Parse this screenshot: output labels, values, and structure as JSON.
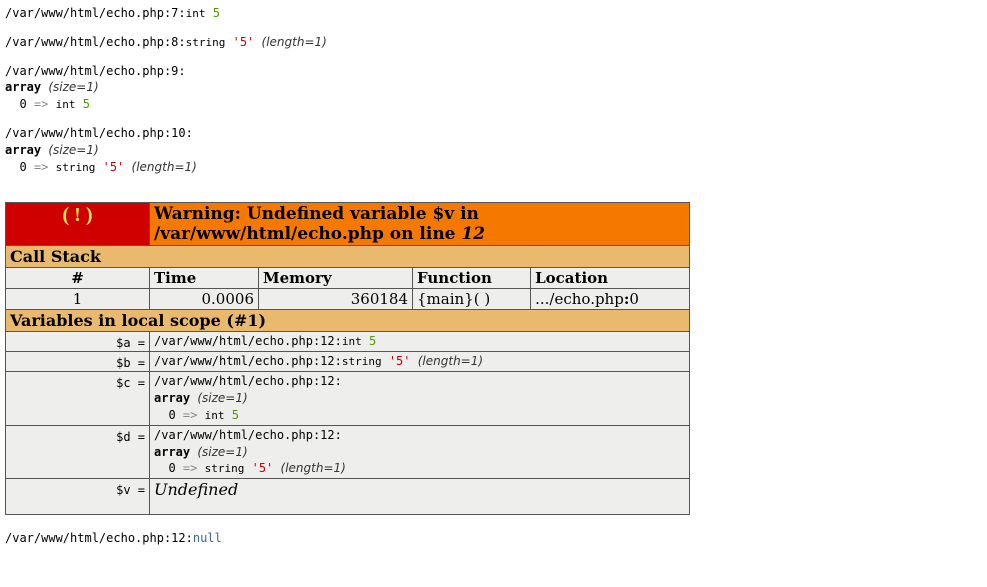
{
  "dump1": {
    "loc": "/var/www/html/echo.php:7:",
    "type": "int",
    "val": "5"
  },
  "dump2": {
    "loc": "/var/www/html/echo.php:8:",
    "type": "string",
    "val": "'5'",
    "len": "(length=1)"
  },
  "dump3": {
    "loc": "/var/www/html/echo.php:9:",
    "head": "array",
    "size": "(size=1)",
    "idx": "0",
    "arrow": "=>",
    "etype": "int",
    "eval": "5"
  },
  "dump4": {
    "loc": "/var/www/html/echo.php:10:",
    "head": "array",
    "size": "(size=1)",
    "idx": "0",
    "arrow": "=>",
    "etype": "string",
    "eval": "'5'",
    "elen": "(length=1)"
  },
  "error": {
    "bang": "( ! )",
    "msg_prefix": "Warning: Undefined variable $v in /var/www/html/echo.php on line ",
    "line": "12",
    "stack_title": "Call Stack",
    "cols": {
      "n": "#",
      "time": "Time",
      "mem": "Memory",
      "func": "Function",
      "loc": "Location"
    },
    "row": {
      "n": "1",
      "time": "0.0006",
      "mem": "360184",
      "func": "{main}( )",
      "loc_prefix": ".../echo.php",
      "loc_colon": ":",
      "loc_line": "0"
    },
    "scope_title": "Variables in local scope (#1)",
    "vars": {
      "a": {
        "name": "$a =",
        "loc": "/var/www/html/echo.php:12:",
        "type": "int",
        "val": "5"
      },
      "b": {
        "name": "$b =",
        "loc": "/var/www/html/echo.php:12:",
        "type": "string",
        "val": "'5'",
        "len": "(length=1)"
      },
      "c": {
        "name": "$c =",
        "loc": "/var/www/html/echo.php:12:",
        "head": "array",
        "size": "(size=1)",
        "idx": "0",
        "arrow": "=>",
        "etype": "int",
        "eval": "5"
      },
      "d": {
        "name": "$d =",
        "loc": "/var/www/html/echo.php:12:",
        "head": "array",
        "size": "(size=1)",
        "idx": "0",
        "arrow": "=>",
        "etype": "string",
        "eval": "'5'",
        "elen": "(length=1)"
      },
      "v": {
        "name": "$v =",
        "undef": "Undefined"
      }
    }
  },
  "dump5": {
    "loc": "/var/www/html/echo.php:12:",
    "val": "null"
  }
}
